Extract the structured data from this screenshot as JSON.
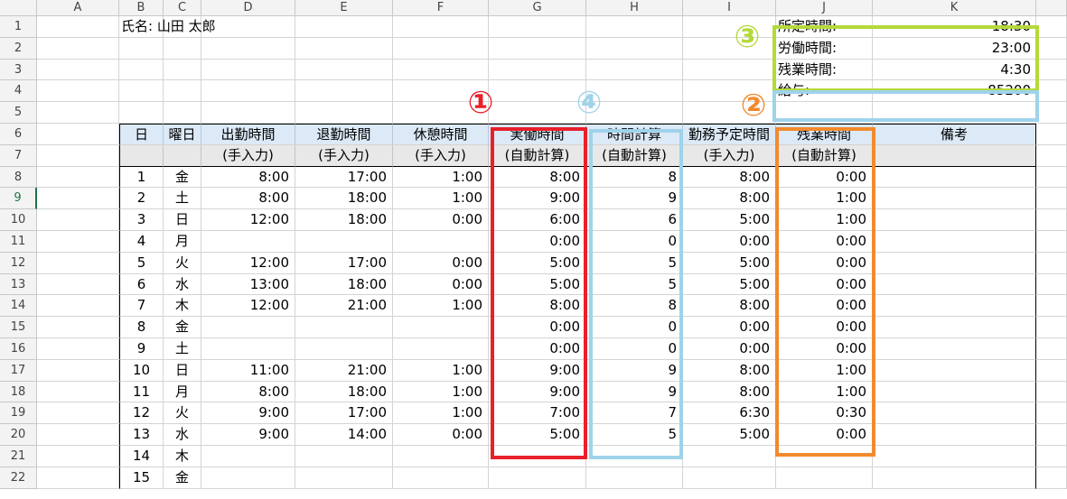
{
  "columns": [
    "A",
    "B",
    "C",
    "D",
    "E",
    "F",
    "G",
    "H",
    "I",
    "J",
    "K"
  ],
  "rows": [
    "1",
    "2",
    "3",
    "4",
    "5",
    "6",
    "7",
    "8",
    "9",
    "10",
    "11",
    "12",
    "13",
    "14",
    "15",
    "16",
    "17",
    "18",
    "19",
    "20",
    "21",
    "22"
  ],
  "name_label": "氏名: 山田 太郎",
  "summary": {
    "scheduled_label": "所定時間:",
    "scheduled_value": "18:30",
    "worked_label": "労働時間:",
    "worked_value": "23:00",
    "overtime_label": "残業時間:",
    "overtime_value": "4:30",
    "salary_label": "給与:",
    "salary_value": "85200"
  },
  "headers1": [
    "日",
    "曜日",
    "出勤時間",
    "退勤時間",
    "休憩時間",
    "実働時間",
    "時間計算",
    "勤務予定時間",
    "残業時間",
    "備考"
  ],
  "headers2": [
    "",
    "",
    "(手入力)",
    "(手入力)",
    "(手入力)",
    "(自動計算)",
    "(自動計算)",
    "(手入力)",
    "(自動計算)",
    ""
  ],
  "data_rows": [
    [
      "1",
      "金",
      "8:00",
      "17:00",
      "1:00",
      "8:00",
      "8",
      "8:00",
      "0:00"
    ],
    [
      "2",
      "土",
      "8:00",
      "18:00",
      "1:00",
      "9:00",
      "9",
      "8:00",
      "1:00"
    ],
    [
      "3",
      "日",
      "12:00",
      "18:00",
      "0:00",
      "6:00",
      "6",
      "5:00",
      "1:00"
    ],
    [
      "4",
      "月",
      "",
      "",
      "",
      "0:00",
      "0",
      "0:00",
      "0:00"
    ],
    [
      "5",
      "火",
      "12:00",
      "17:00",
      "0:00",
      "5:00",
      "5",
      "5:00",
      "0:00"
    ],
    [
      "6",
      "水",
      "13:00",
      "18:00",
      "0:00",
      "5:00",
      "5",
      "5:00",
      "0:00"
    ],
    [
      "7",
      "木",
      "12:00",
      "21:00",
      "1:00",
      "8:00",
      "8",
      "8:00",
      "0:00"
    ],
    [
      "8",
      "金",
      "",
      "",
      "",
      "0:00",
      "0",
      "0:00",
      "0:00"
    ],
    [
      "9",
      "土",
      "",
      "",
      "",
      "0:00",
      "0",
      "0:00",
      "0:00"
    ],
    [
      "10",
      "日",
      "11:00",
      "21:00",
      "1:00",
      "9:00",
      "9",
      "8:00",
      "1:00"
    ],
    [
      "11",
      "月",
      "8:00",
      "18:00",
      "1:00",
      "9:00",
      "9",
      "8:00",
      "1:00"
    ],
    [
      "12",
      "火",
      "9:00",
      "17:00",
      "1:00",
      "7:00",
      "7",
      "6:30",
      "0:30"
    ],
    [
      "13",
      "水",
      "9:00",
      "14:00",
      "0:00",
      "5:00",
      "5",
      "5:00",
      "0:00"
    ],
    [
      "14",
      "木",
      "",
      "",
      "",
      "",
      "",
      "",
      ""
    ],
    [
      "15",
      "金",
      "",
      "",
      "",
      "",
      "",
      "",
      ""
    ]
  ],
  "markers": [
    {
      "label": "①",
      "color": "#e8202a"
    },
    {
      "label": "②",
      "color": "#f28a2e"
    },
    {
      "label": "③",
      "color": "#b5d93b"
    },
    {
      "label": "④",
      "color": "#9fd3ea"
    }
  ],
  "selected_row": "9"
}
